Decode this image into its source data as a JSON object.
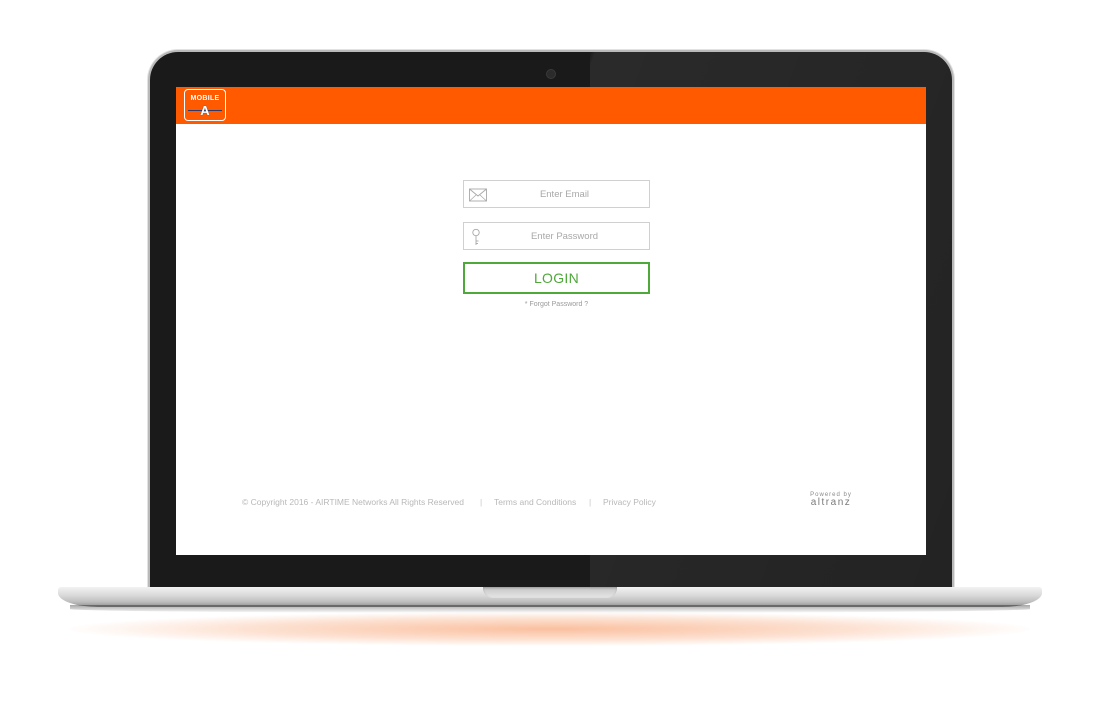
{
  "app": {
    "brand_color": "#ff5a00",
    "accent_color": "#4ea83a",
    "logo": {
      "top_text": "MOBILE",
      "letter": "A"
    }
  },
  "login": {
    "email_placeholder": "Enter Email",
    "email_icon": "envelope-icon",
    "password_placeholder": "Enter Password",
    "password_icon": "key-icon",
    "button_label": "LOGIN",
    "forgot_label": "* Forgot Password ?"
  },
  "footer": {
    "copyright": "© Copyright 2016 - AIRTIME Networks All Rights Reserved",
    "separator": "|",
    "terms": "Terms and Conditions",
    "privacy": "Privacy Policy",
    "powered_by_label": "Powered by",
    "powered_by_brand": "altranz"
  }
}
